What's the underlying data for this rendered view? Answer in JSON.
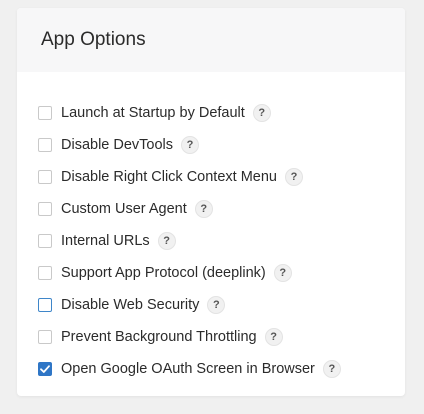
{
  "panel": {
    "title": "App Options"
  },
  "options": [
    {
      "label": "Launch at Startup by Default",
      "checked": false,
      "help": "?"
    },
    {
      "label": "Disable DevTools",
      "checked": false,
      "help": "?"
    },
    {
      "label": "Disable Right Click Context Menu",
      "checked": false,
      "help": "?"
    },
    {
      "label": "Custom User Agent",
      "checked": false,
      "help": "?"
    },
    {
      "label": "Internal URLs",
      "checked": false,
      "help": "?"
    },
    {
      "label": "Support App Protocol (deeplink)",
      "checked": false,
      "help": "?"
    },
    {
      "label": "Disable Web Security",
      "checked": false,
      "focused": true,
      "help": "?"
    },
    {
      "label": "Prevent Background Throttling",
      "checked": false,
      "help": "?"
    },
    {
      "label": "Open Google OAuth Screen in Browser",
      "checked": true,
      "help": "?"
    }
  ],
  "colors": {
    "accent": "#2f76c6",
    "focus_border": "#3f86c9",
    "header_bg": "#f7f7f8",
    "page_bg": "#f0f0f0"
  },
  "icons": {
    "checked": "checkmark-icon",
    "help": "question-mark-icon"
  }
}
